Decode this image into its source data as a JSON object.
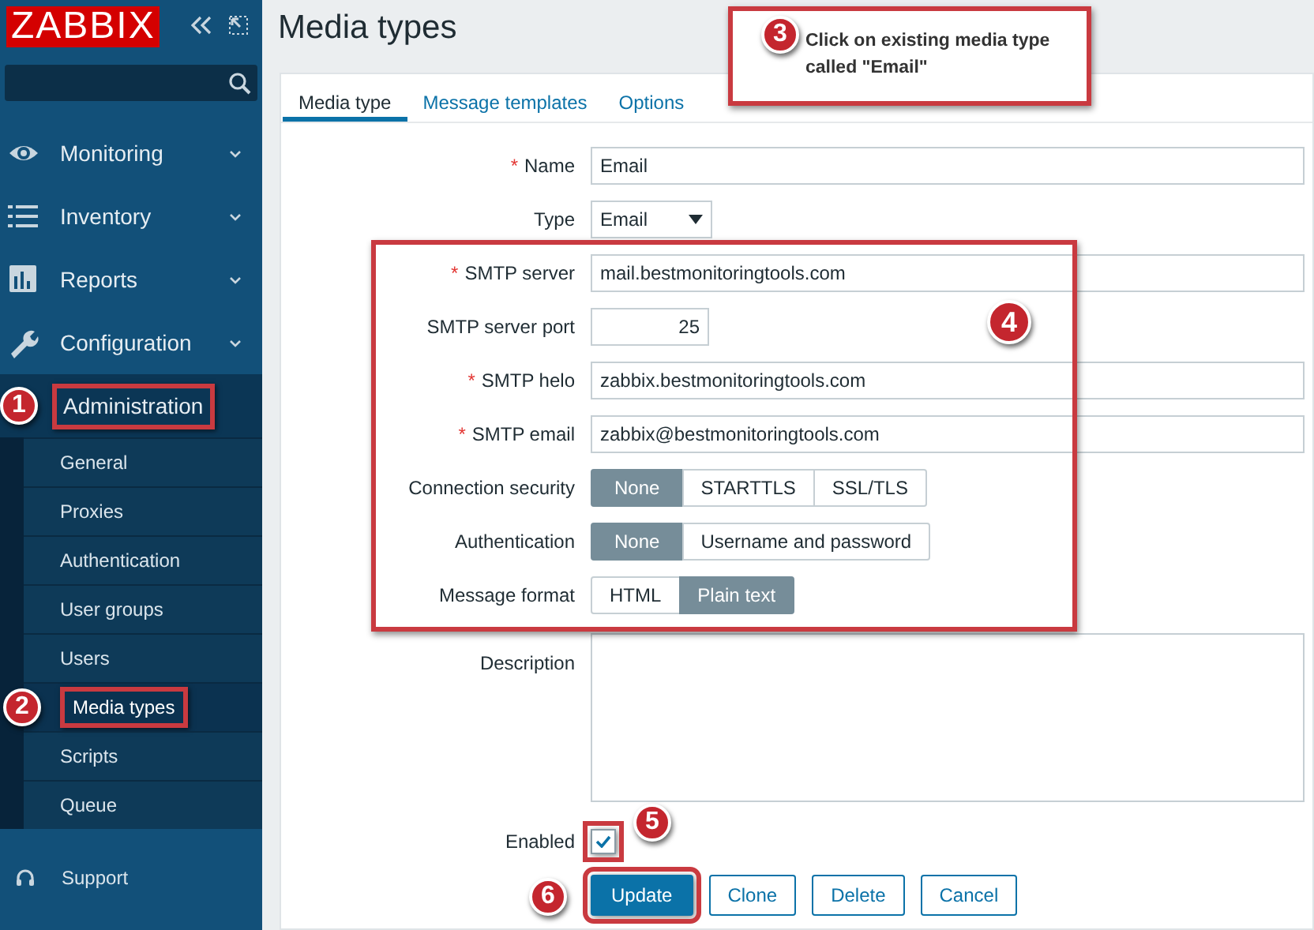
{
  "logo": "ZABBIX",
  "menu": [
    {
      "label": "Monitoring",
      "expanded": false
    },
    {
      "label": "Inventory",
      "expanded": false
    },
    {
      "label": "Reports",
      "expanded": false
    },
    {
      "label": "Configuration",
      "expanded": false
    },
    {
      "label": "Administration",
      "expanded": true,
      "annotation": "1",
      "children": [
        {
          "label": "General",
          "selected": false
        },
        {
          "label": "Proxies",
          "selected": false
        },
        {
          "label": "Authentication",
          "selected": false
        },
        {
          "label": "User groups",
          "selected": false
        },
        {
          "label": "Users",
          "selected": false
        },
        {
          "label": "Media types",
          "selected": true,
          "annotation": "2"
        },
        {
          "label": "Scripts",
          "selected": false
        },
        {
          "label": "Queue",
          "selected": false
        }
      ]
    }
  ],
  "support": "Support",
  "page_title": "Media types",
  "callout": {
    "number": "3",
    "text": "Click on existing media type called \"Email\""
  },
  "tabs": [
    {
      "label": "Media type",
      "selected": true
    },
    {
      "label": "Message templates",
      "selected": false
    },
    {
      "label": "Options",
      "selected": false
    }
  ],
  "rows": [
    {
      "kind": "text",
      "label": "Name",
      "required_mark": "*",
      "value": "Email"
    },
    {
      "kind": "select",
      "label": "Type",
      "value": "Email"
    },
    {
      "kind": "group",
      "annotation": "4",
      "rows": [
        {
          "kind": "text",
          "label": "SMTP server",
          "required_mark": "*",
          "value": "mail.bestmonitoringtools.com"
        },
        {
          "kind": "number",
          "label": "SMTP server port",
          "value": "25"
        },
        {
          "kind": "text",
          "label": "SMTP helo",
          "required_mark": "*",
          "value": "zabbix.bestmonitoringtools.com"
        },
        {
          "kind": "text",
          "label": "SMTP email",
          "required_mark": "*",
          "value": "zabbix@bestmonitoringtools.com"
        },
        {
          "kind": "segmented",
          "label": "Connection security",
          "options": [
            {
              "label": "None",
              "selected": true
            },
            {
              "label": "STARTTLS",
              "selected": false
            },
            {
              "label": "SSL/TLS",
              "selected": false
            }
          ]
        },
        {
          "kind": "segmented",
          "label": "Authentication",
          "options": [
            {
              "label": "None",
              "selected": true
            },
            {
              "label": "Username and password",
              "selected": false
            }
          ]
        },
        {
          "kind": "segmented",
          "label": "Message format",
          "options": [
            {
              "label": "HTML",
              "selected": false
            },
            {
              "label": "Plain text",
              "selected": true
            }
          ]
        }
      ]
    },
    {
      "kind": "textarea",
      "label": "Description"
    },
    {
      "kind": "checkbox",
      "label": "Enabled",
      "checked": true,
      "annotation": "5"
    }
  ],
  "buttons": [
    {
      "label": "Update",
      "primary": true,
      "annotation": "6"
    },
    {
      "label": "Clone",
      "primary": false
    },
    {
      "label": "Delete",
      "primary": false
    },
    {
      "label": "Cancel",
      "primary": false
    }
  ]
}
